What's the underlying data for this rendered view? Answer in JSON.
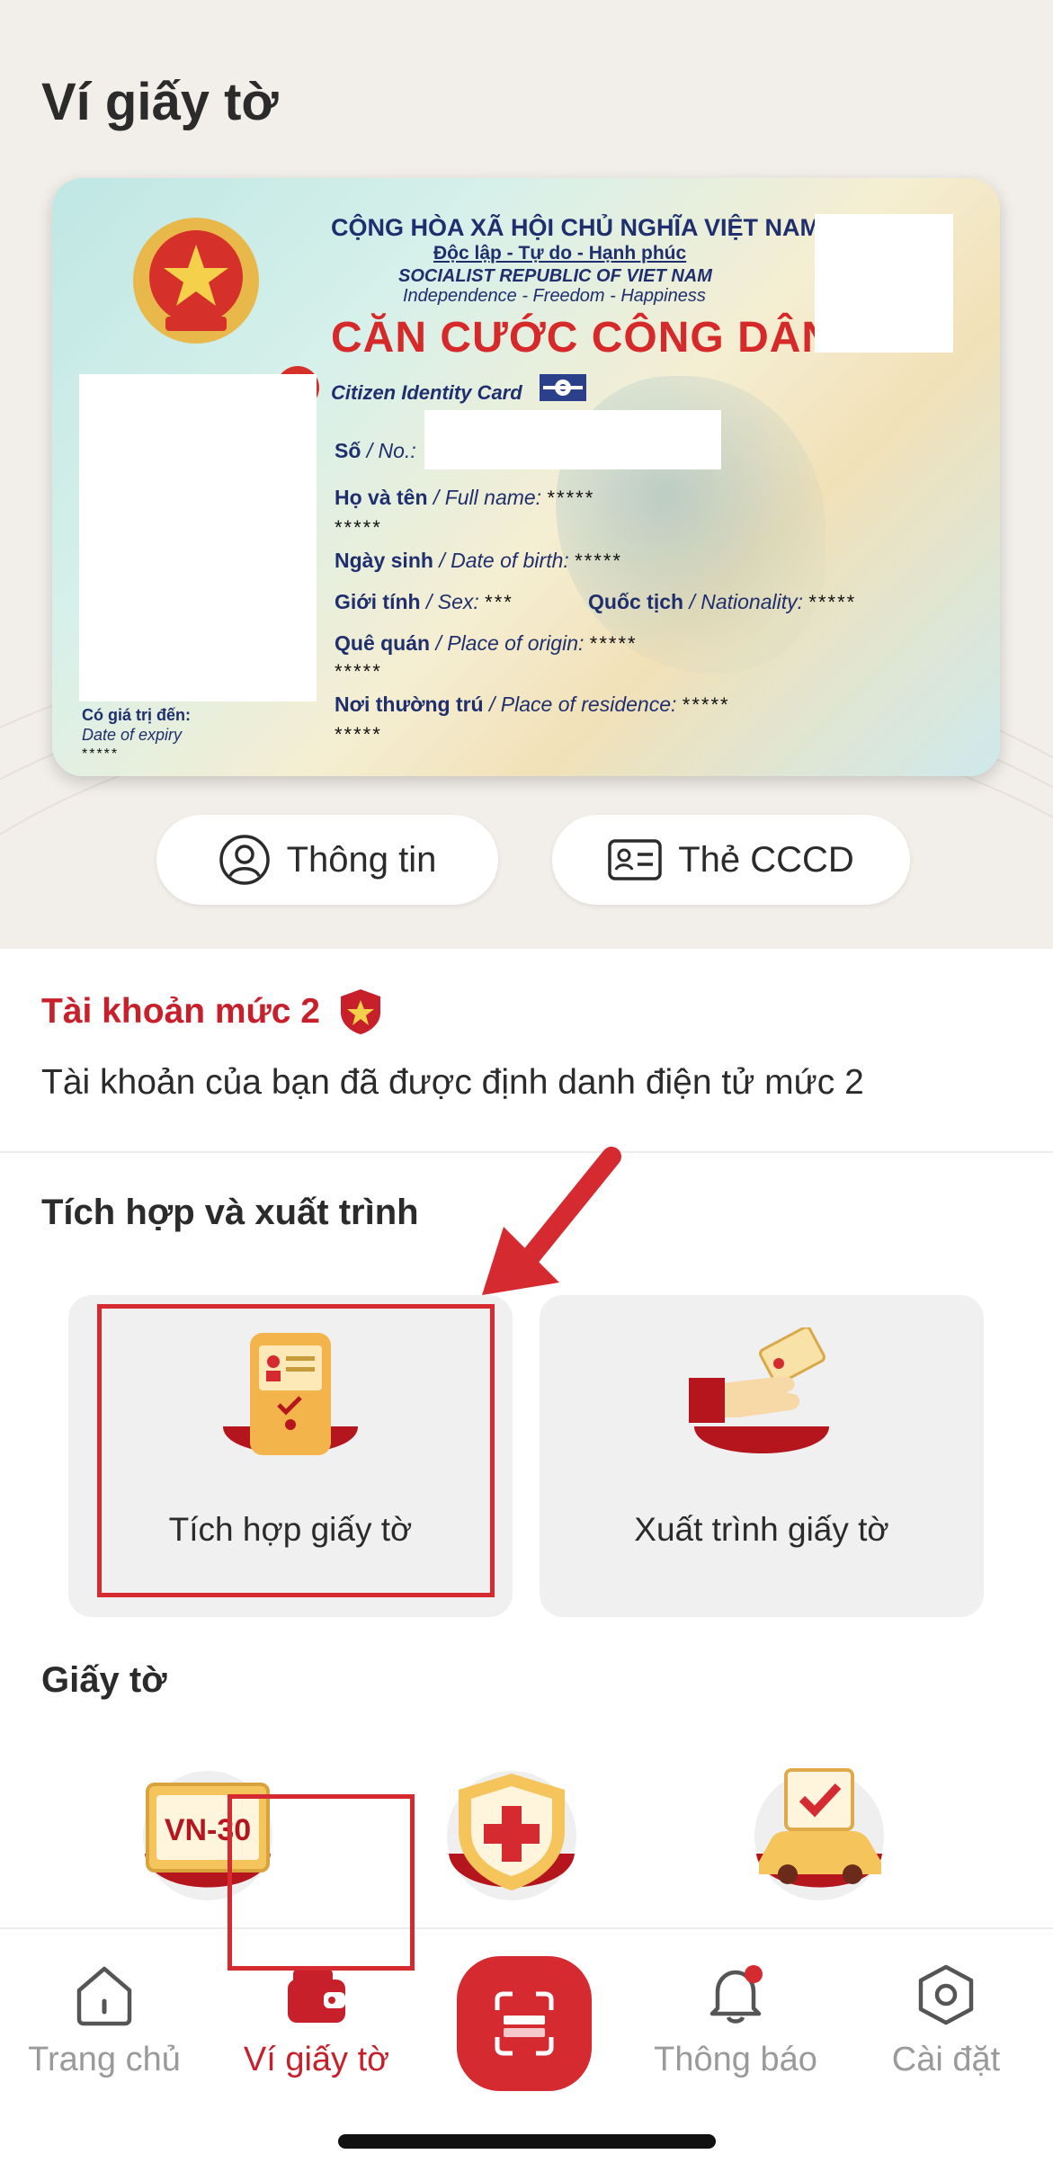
{
  "page": {
    "title": "Ví giấy tờ"
  },
  "id_card": {
    "header_line1": "CỘNG HÒA XÃ HỘI CHỦ NGHĨA VIỆT NAM",
    "header_line2": "Độc lập - Tự do - Hạnh phúc",
    "header_line3": "SOCIALIST REPUBLIC OF VIET NAM",
    "header_line4": "Independence - Freedom - Happiness",
    "title": "CĂN CƯỚC CÔNG DÂN",
    "subtitle": "Citizen Identity Card",
    "number_label_vi": "Số",
    "number_label_en": "/ No.:",
    "fullname_label_vi": "Họ và tên",
    "fullname_label_en": "/ Full name:",
    "fullname_value_1": "*****",
    "fullname_value_2": "*****",
    "dob_label_vi": "Ngày sinh",
    "dob_label_en": "/ Date of birth:",
    "dob_value": "*****",
    "sex_label_vi": "Giới tính",
    "sex_label_en": "/ Sex:",
    "sex_value": "***",
    "nationality_label_vi": "Quốc tịch",
    "nationality_label_en": "/ Nationality:",
    "nationality_value": "*****",
    "origin_label_vi": "Quê quán",
    "origin_label_en": "/ Place of origin:",
    "origin_value_1": "*****",
    "origin_value_2": "*****",
    "residence_label_vi": "Nơi thường trú",
    "residence_label_en": "/ Place of residence:",
    "residence_value_1": "*****",
    "residence_value_2": "*****",
    "expiry_label_vi": "Có giá trị đến:",
    "expiry_label_en": "Date of expiry",
    "expiry_value": "*****"
  },
  "card_actions": {
    "info_label": "Thông tin",
    "cccd_label": "Thẻ CCCD"
  },
  "account": {
    "level_title": "Tài khoản mức 2",
    "level_description": "Tài khoản của bạn đã được định danh điện tử mức 2"
  },
  "integration": {
    "section_title": "Tích hợp và xuất trình",
    "tiles": [
      {
        "label": "Tích hợp giấy tờ",
        "icon": "phone-id-icon"
      },
      {
        "label": "Xuất trình giấy tờ",
        "icon": "hand-card-icon"
      }
    ]
  },
  "documents": {
    "section_title": "Giấy tờ",
    "items": [
      {
        "icon": "license-plate-icon",
        "plate_text": "VN-30"
      },
      {
        "icon": "health-insurance-icon"
      },
      {
        "icon": "vehicle-registration-icon"
      }
    ]
  },
  "bottom_nav": {
    "home_label": "Trang chủ",
    "wallet_label": "Ví giấy tờ",
    "notify_label": "Thông báo",
    "settings_label": "Cài đặt",
    "active": "wallet"
  },
  "colors": {
    "accent": "#d62a31",
    "brand_red": "#c8202b",
    "card_title_red": "#d5292a",
    "card_text_blue": "#1f2f6e"
  }
}
